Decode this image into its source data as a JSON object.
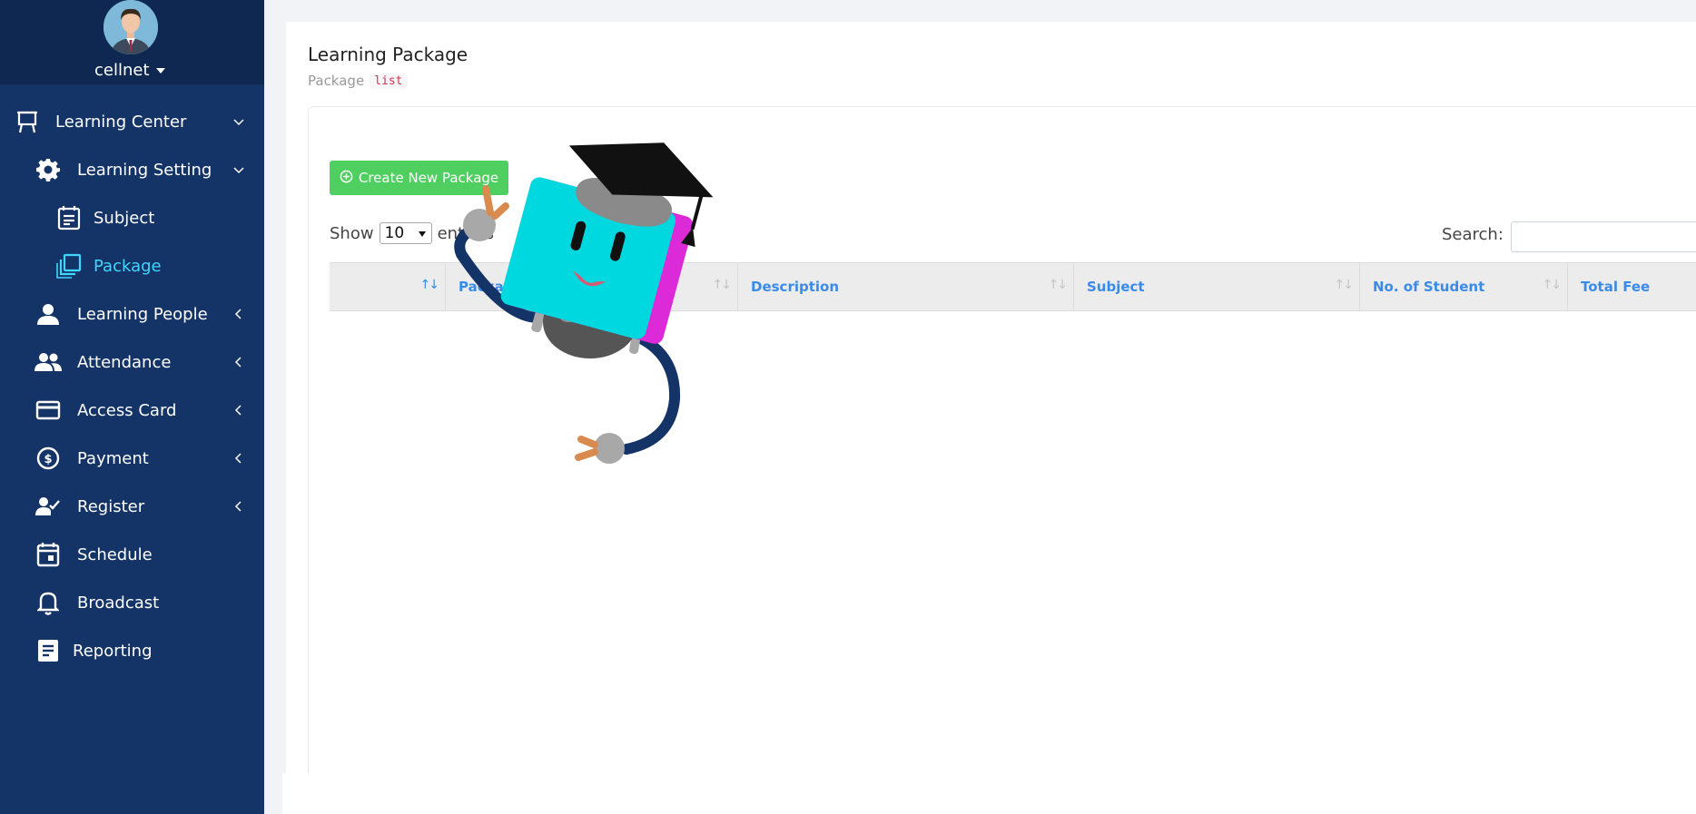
{
  "user": {
    "name": "cellnet"
  },
  "sidebar": {
    "items": [
      {
        "label": "Learning Center",
        "icon": "presentation-board-icon"
      },
      {
        "label": "Learning Setting",
        "icon": "gear-icon"
      },
      {
        "label": "Subject",
        "icon": "calendar-note-icon"
      },
      {
        "label": "Package",
        "icon": "layers-icon"
      },
      {
        "label": "Learning People",
        "icon": "person-icon"
      },
      {
        "label": "Attendance",
        "icon": "people-icon"
      },
      {
        "label": "Access Card",
        "icon": "credit-card-icon"
      },
      {
        "label": "Payment",
        "icon": "dollar-circle-icon"
      },
      {
        "label": "Register",
        "icon": "person-check-icon"
      },
      {
        "label": "Schedule",
        "icon": "calendar-event-icon"
      },
      {
        "label": "Broadcast",
        "icon": "bell-icon"
      },
      {
        "label": "Reporting",
        "icon": "document-list-icon"
      }
    ]
  },
  "page": {
    "title": "Learning Package",
    "subtitle_text": "Package",
    "subtitle_code": "list"
  },
  "toolbar": {
    "create_label": "Create New Package",
    "show_label": "Show",
    "page_size": "10",
    "entries_label": "entries",
    "search_label": "Search:"
  },
  "table": {
    "columns": [
      "",
      "Package Name",
      "Description",
      "Subject",
      "No. of Student",
      "Total Fee"
    ]
  },
  "colors": {
    "sidebar_bg": "#143366",
    "active_item": "#3fd6ff",
    "create_button": "#4fcf5f",
    "table_header_text": "#3a8be8"
  }
}
